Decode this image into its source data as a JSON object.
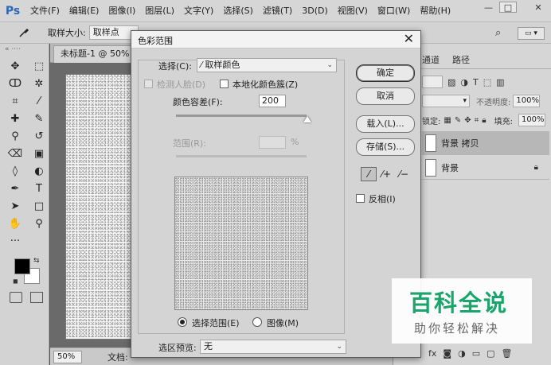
{
  "app": {
    "logo": "Ps",
    "menu": [
      "文件(F)",
      "编辑(E)",
      "图像(I)",
      "图层(L)",
      "文字(Y)",
      "选择(S)",
      "滤镜(T)",
      "3D(D)",
      "视图(V)",
      "窗口(W)",
      "帮助(H)"
    ],
    "window_controls": {
      "minimize": "—",
      "maximize": "□",
      "close": "✕"
    }
  },
  "options_bar": {
    "sample_size_label": "取样大小:",
    "sample_size_value": "取样点"
  },
  "document": {
    "tab_title": "未标题-1 @ 50% (背",
    "zoom": "50%",
    "info_label": "文档:"
  },
  "panels": {
    "tabs": [
      "通道",
      "路径"
    ],
    "opacity_label": "不透明度:",
    "opacity_value": "100%",
    "lock_label": "锁定:",
    "fill_label": "填充:",
    "fill_value": "100%",
    "layers": [
      {
        "name": "背景 拷贝",
        "selected": true
      },
      {
        "name": "背景",
        "selected": false,
        "locked": true
      }
    ]
  },
  "dialog": {
    "title": "色彩范围",
    "close": "✕",
    "select_label": "选择(C):",
    "select_value": "取样颜色",
    "detect_faces_label": "检测人脸(D)",
    "localized_label": "本地化颜色簇(Z)",
    "fuzziness_label": "颜色容差(F):",
    "fuzziness_value": "200",
    "range_label": "范围(R):",
    "range_unit": "%",
    "radio_selection": "选择范围(E)",
    "radio_image": "图像(M)",
    "preview_label": "选区预览:",
    "preview_value": "无",
    "buttons": {
      "ok": "确定",
      "cancel": "取消",
      "load": "载入(L)...",
      "save": "存储(S)..."
    },
    "invert_label": "反相(I)"
  },
  "watermark": {
    "title": "百科全说",
    "subtitle": "助你轻松解决"
  }
}
